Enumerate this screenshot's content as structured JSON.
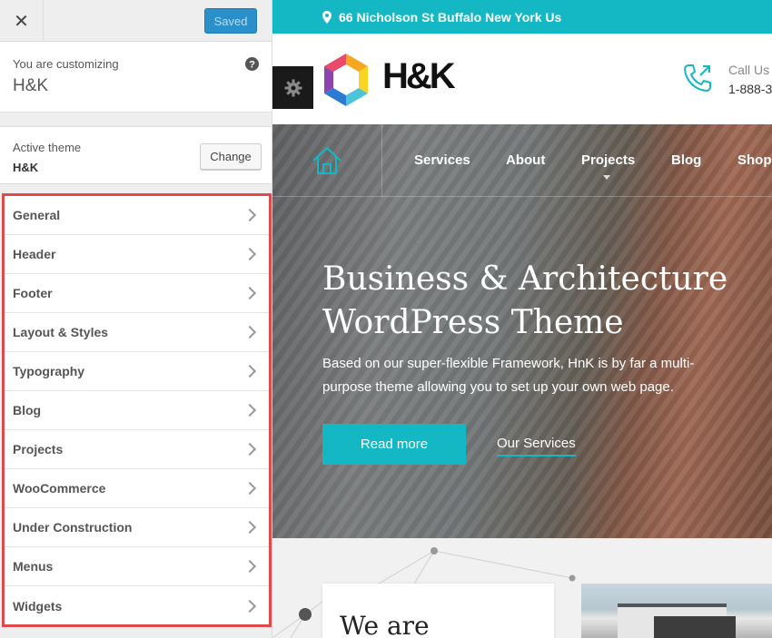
{
  "customizer": {
    "close_icon": "close-icon",
    "saved_label": "Saved",
    "customizing_label": "You are customizing",
    "site_name": "H&K",
    "help_icon": "help-icon",
    "active_theme_label": "Active theme",
    "active_theme_name": "H&K",
    "change_label": "Change",
    "highlight_color": "#e04a4a",
    "panels": [
      {
        "label": "General"
      },
      {
        "label": "Header"
      },
      {
        "label": "Footer"
      },
      {
        "label": "Layout & Styles"
      },
      {
        "label": "Typography"
      },
      {
        "label": "Blog"
      },
      {
        "label": "Projects"
      },
      {
        "label": "WooCommerce"
      },
      {
        "label": "Under Construction"
      },
      {
        "label": "Menus"
      },
      {
        "label": "Widgets"
      }
    ]
  },
  "preview": {
    "accent_color": "#13b8c4",
    "address": "66 Nicholson St Buffalo New York Us",
    "brand": "H&K",
    "call_label": "Call Us",
    "call_number": "1-888-3",
    "nav": [
      "Services",
      "About",
      "Projects",
      "Blog",
      "Shop"
    ],
    "hero_title_line1": "Business & Architecture",
    "hero_title_line2": "WordPress Theme",
    "hero_desc_line1": "Based on our super-flexible Framework, HnK is by far a multi-",
    "hero_desc_line2": "purpose theme allowing you to set up your own web page.",
    "read_more": "Read more",
    "our_services": "Our Services",
    "we_are": "We are"
  }
}
